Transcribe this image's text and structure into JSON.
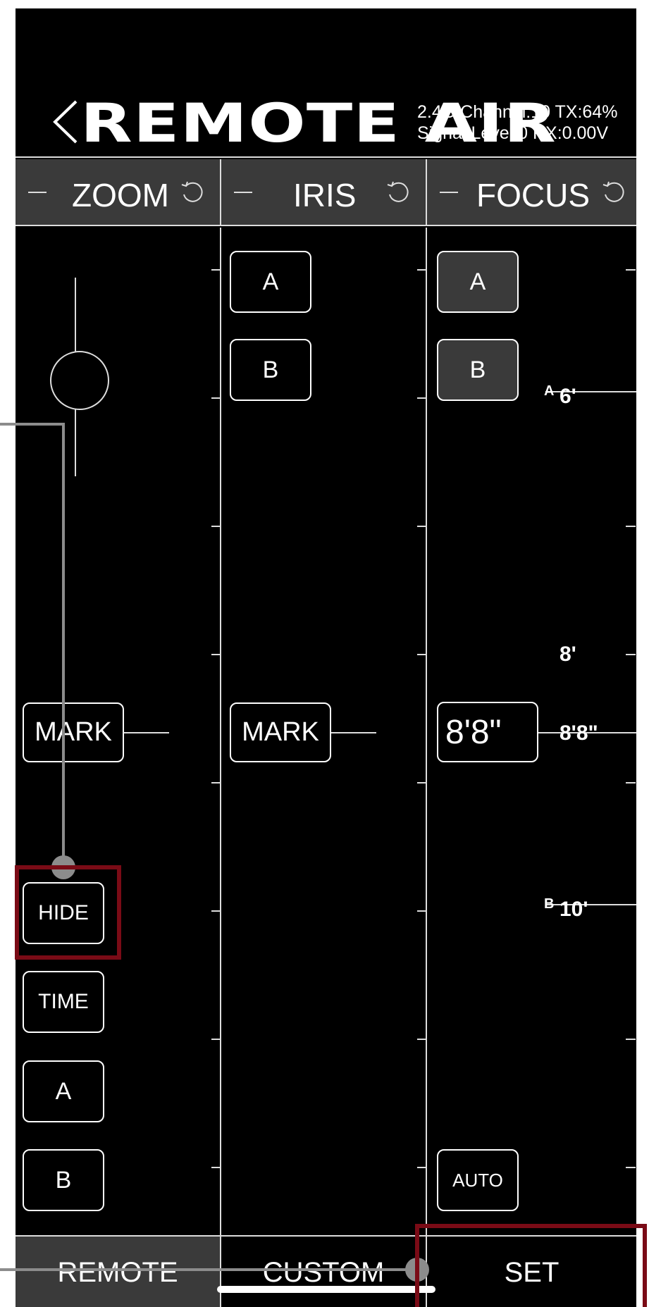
{
  "header": {
    "title": "REMOTE AIR",
    "status_line1": "2.4G Channel:10 TX:64%",
    "status_line2": "Signal Level:0 RX:0.00V"
  },
  "columns": {
    "zoom": "ZOOM",
    "iris": "IRIS",
    "focus": "FOCUS"
  },
  "zoom_panel": {
    "mark": "MARK",
    "hide": "HIDE",
    "time": "TIME",
    "a": "A",
    "b": "B"
  },
  "iris_panel": {
    "a": "A",
    "b": "B",
    "mark": "MARK"
  },
  "focus_panel": {
    "a": "A",
    "b": "B",
    "current_value": "8'8\"",
    "auto": "AUTO",
    "scale": {
      "label_6": "6'",
      "marker_a": "A",
      "label_8": "8'",
      "label_8_8": "8'8\"",
      "label_10": "10'",
      "marker_b": "B"
    }
  },
  "tabs": {
    "remote": "REMOTE",
    "custom": "CUSTOM",
    "set": "SET"
  },
  "colors": {
    "background": "#000000",
    "header_bar": "#3a3a3a",
    "active_tab": "#3a3a3a",
    "annotation_red": "#7a0b16",
    "annotation_gray": "#8c8c8c"
  }
}
